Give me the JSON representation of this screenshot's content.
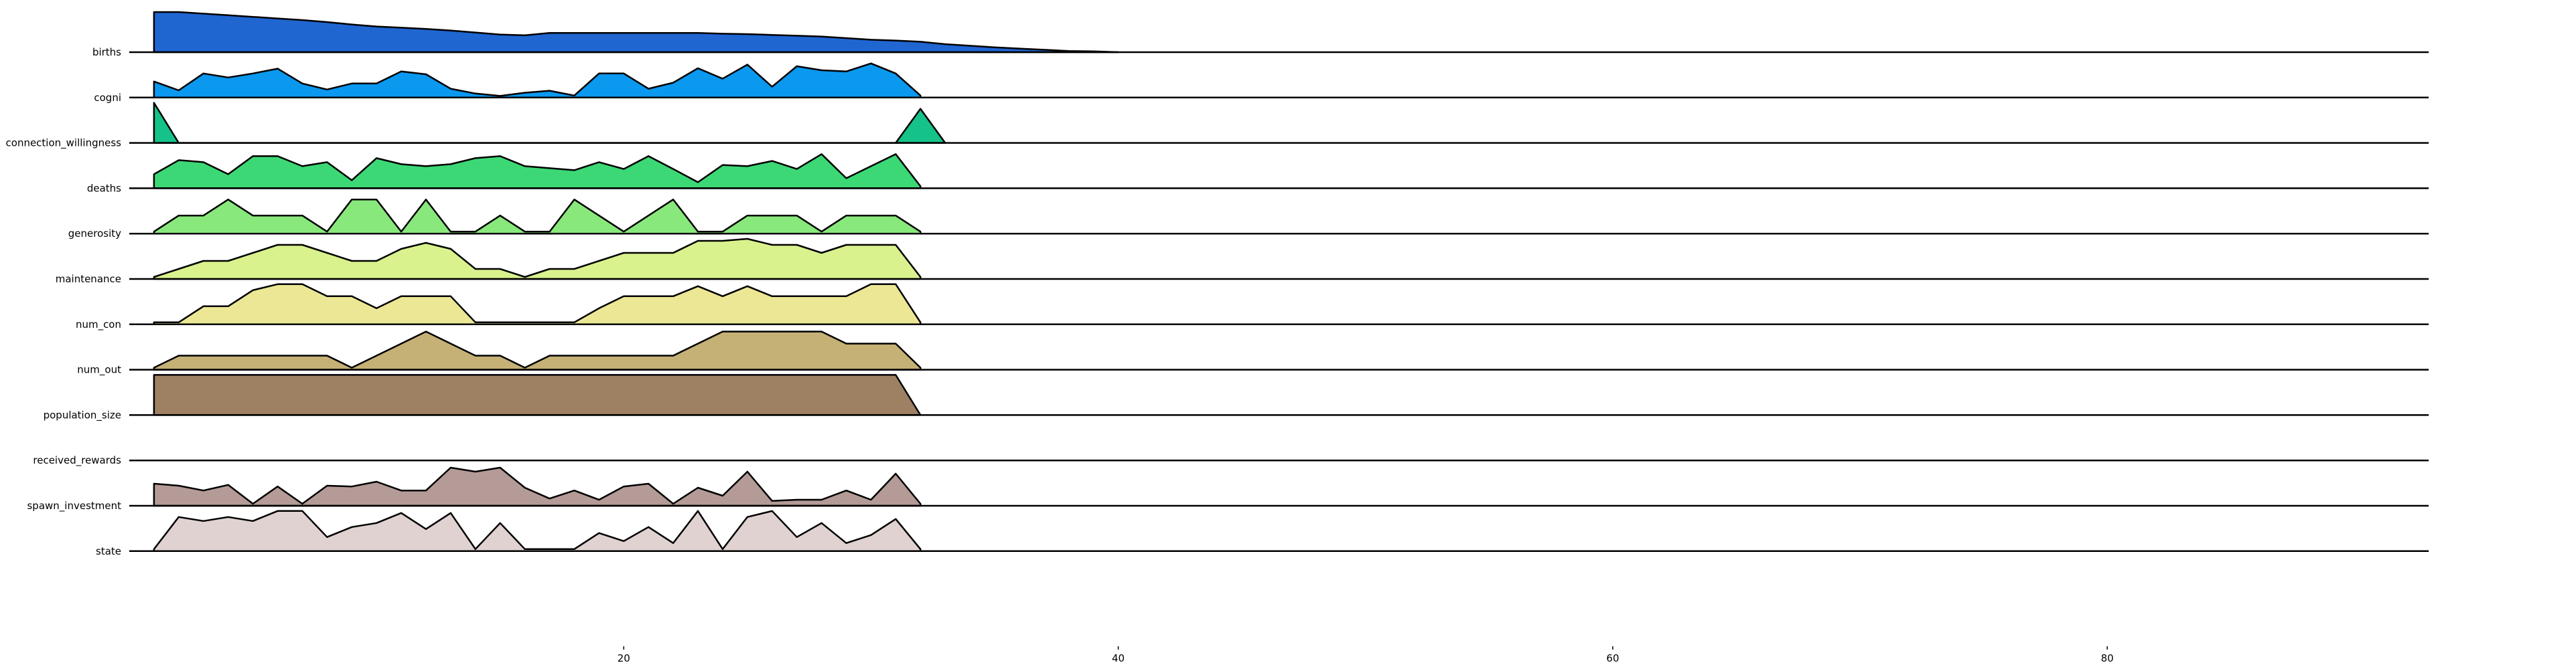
{
  "chart_data": {
    "type": "area",
    "subtype": "ridgeline",
    "x_ticks": [
      20,
      40,
      60,
      80
    ],
    "xlim": [
      0,
      93
    ],
    "rows": [
      {
        "name": "births",
        "color": "#1f66d1",
        "values": [
          1.0,
          1.0,
          0.96,
          0.92,
          0.88,
          0.84,
          0.8,
          0.75,
          0.69,
          0.64,
          0.61,
          0.58,
          0.54,
          0.49,
          0.44,
          0.42,
          0.48,
          0.48,
          0.48,
          0.48,
          0.48,
          0.48,
          0.48,
          0.46,
          0.45,
          0.43,
          0.41,
          0.39,
          0.35,
          0.31,
          0.29,
          0.26,
          0.2,
          0.16,
          0.12,
          0.09,
          0.06,
          0.03,
          0.02,
          0.0
        ]
      },
      {
        "name": "cogni",
        "color": "#0b98ef",
        "values": [
          0.4,
          0.18,
          0.6,
          0.5,
          0.6,
          0.72,
          0.35,
          0.2,
          0.35,
          0.35,
          0.65,
          0.58,
          0.22,
          0.1,
          0.04,
          0.12,
          0.17,
          0.05,
          0.6,
          0.6,
          0.22,
          0.37,
          0.73,
          0.47,
          0.82,
          0.27,
          0.78,
          0.68,
          0.65,
          0.85,
          0.6,
          0.05
        ]
      },
      {
        "name": "connection_willingness",
        "color": "#15c28a",
        "values": [
          1.0,
          0.0,
          0.0,
          0.0,
          0.0,
          0.0,
          0.0,
          0.0,
          0.0,
          0.0,
          0.0,
          0.0,
          0.0,
          0.0,
          0.0,
          0.0,
          0.0,
          0.0,
          0.0,
          0.0,
          0.0,
          0.0,
          0.0,
          0.0,
          0.0,
          0.0,
          0.0,
          0.0,
          0.0,
          0.0,
          0.0,
          0.85,
          0.0
        ]
      },
      {
        "name": "deaths",
        "color": "#3dd876",
        "values": [
          0.35,
          0.7,
          0.65,
          0.35,
          0.8,
          0.8,
          0.55,
          0.65,
          0.2,
          0.75,
          0.6,
          0.55,
          0.6,
          0.75,
          0.8,
          0.55,
          0.5,
          0.45,
          0.65,
          0.48,
          0.8,
          0.48,
          0.15,
          0.58,
          0.55,
          0.68,
          0.48,
          0.85,
          0.25,
          0.55,
          0.85,
          0.05
        ]
      },
      {
        "name": "generosity",
        "color": "#89e87c",
        "values": [
          0.05,
          0.45,
          0.45,
          0.85,
          0.45,
          0.45,
          0.45,
          0.05,
          0.85,
          0.85,
          0.05,
          0.85,
          0.05,
          0.05,
          0.45,
          0.05,
          0.05,
          0.85,
          0.45,
          0.05,
          0.45,
          0.85,
          0.05,
          0.05,
          0.45,
          0.45,
          0.45,
          0.05,
          0.45,
          0.45,
          0.45,
          0.05
        ]
      },
      {
        "name": "maintenance",
        "color": "#d9f28e",
        "values": [
          0.05,
          0.25,
          0.45,
          0.45,
          0.65,
          0.85,
          0.85,
          0.65,
          0.45,
          0.45,
          0.75,
          0.9,
          0.75,
          0.25,
          0.25,
          0.05,
          0.25,
          0.25,
          0.45,
          0.65,
          0.65,
          0.65,
          0.95,
          0.95,
          1.0,
          0.85,
          0.85,
          0.65,
          0.85,
          0.85,
          0.85,
          0.05
        ]
      },
      {
        "name": "num_con",
        "color": "#ece795",
        "values": [
          0.05,
          0.05,
          0.45,
          0.45,
          0.85,
          1.0,
          1.0,
          0.7,
          0.7,
          0.4,
          0.7,
          0.7,
          0.7,
          0.05,
          0.05,
          0.05,
          0.05,
          0.05,
          0.4,
          0.7,
          0.7,
          0.7,
          0.95,
          0.7,
          0.95,
          0.7,
          0.7,
          0.7,
          0.7,
          1.0,
          1.0,
          0.05
        ]
      },
      {
        "name": "num_out",
        "color": "#c5b176",
        "values": [
          0.05,
          0.35,
          0.35,
          0.35,
          0.35,
          0.35,
          0.35,
          0.35,
          0.05,
          0.35,
          0.65,
          0.95,
          0.65,
          0.35,
          0.35,
          0.05,
          0.35,
          0.35,
          0.35,
          0.35,
          0.35,
          0.35,
          0.65,
          0.95,
          0.95,
          0.95,
          0.95,
          0.95,
          0.65,
          0.65,
          0.65,
          0.05
        ]
      },
      {
        "name": "population_size",
        "color": "#9e8063",
        "values": [
          1.0,
          1.0,
          1.0,
          1.0,
          1.0,
          1.0,
          1.0,
          1.0,
          1.0,
          1.0,
          1.0,
          1.0,
          1.0,
          1.0,
          1.0,
          1.0,
          1.0,
          1.0,
          1.0,
          1.0,
          1.0,
          1.0,
          1.0,
          1.0,
          1.0,
          1.0,
          1.0,
          1.0,
          1.0,
          1.0,
          1.0,
          0.0
        ]
      },
      {
        "name": "received_rewards",
        "color": "#b49b97",
        "values": [
          0.0
        ]
      },
      {
        "name": "spawn_investment",
        "color": "#b49b97",
        "values": [
          0.55,
          0.5,
          0.38,
          0.52,
          0.05,
          0.48,
          0.05,
          0.5,
          0.48,
          0.6,
          0.38,
          0.38,
          0.95,
          0.85,
          0.95,
          0.45,
          0.18,
          0.38,
          0.15,
          0.48,
          0.55,
          0.05,
          0.45,
          0.25,
          0.85,
          0.12,
          0.15,
          0.15,
          0.38,
          0.15,
          0.8,
          0.05
        ]
      },
      {
        "name": "state",
        "color": "#dfd2d0",
        "values": [
          0.05,
          0.85,
          0.75,
          0.85,
          0.75,
          1.0,
          1.0,
          0.35,
          0.6,
          0.7,
          0.95,
          0.55,
          0.95,
          0.05,
          0.7,
          0.05,
          0.05,
          0.05,
          0.45,
          0.25,
          0.6,
          0.2,
          1.0,
          0.05,
          0.85,
          1.0,
          0.35,
          0.7,
          0.2,
          0.4,
          0.8,
          0.05
        ]
      }
    ]
  }
}
